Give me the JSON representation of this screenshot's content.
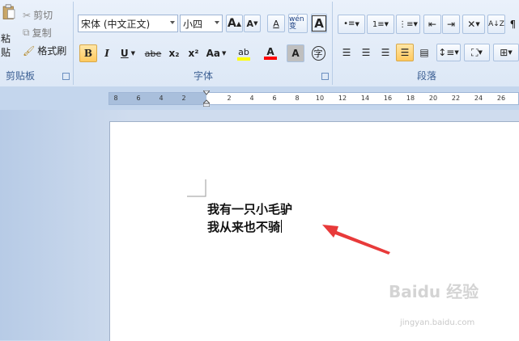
{
  "clipboard": {
    "paste_label": "粘贴",
    "cut_label": "剪切",
    "copy_label": "复制",
    "format_painter_label": "格式刷",
    "group_label": "剪贴板"
  },
  "font": {
    "font_name": "宋体 (中文正文)",
    "font_size": "小四",
    "grow_label": "A",
    "shrink_label": "A",
    "clear_label": "A",
    "phonetic_label": "wén 变",
    "border_label": "A",
    "bold_label": "B",
    "italic_label": "I",
    "underline_label": "U",
    "strike_label": "abe",
    "subscript_label": "x₂",
    "superscript_label": "x²",
    "case_label": "Aa",
    "highlight_label": "ab",
    "font_color_label": "A",
    "shading_label": "A",
    "enclose_label": "字",
    "group_label": "字体",
    "highlight_color": "#ffff00",
    "font_color": "#ff0000"
  },
  "paragraph": {
    "group_label": "段落"
  },
  "ruler": {
    "ticks": [
      "8",
      "6",
      "4",
      "2",
      "2",
      "4",
      "6",
      "8",
      "10",
      "12",
      "14",
      "16",
      "18",
      "20",
      "22",
      "24",
      "26"
    ]
  },
  "document": {
    "lines": [
      "我有一只小毛驴",
      "我从来也不骑"
    ]
  },
  "watermark": {
    "brand": "Baidu 经验",
    "url": "jingyan.baidu.com"
  }
}
